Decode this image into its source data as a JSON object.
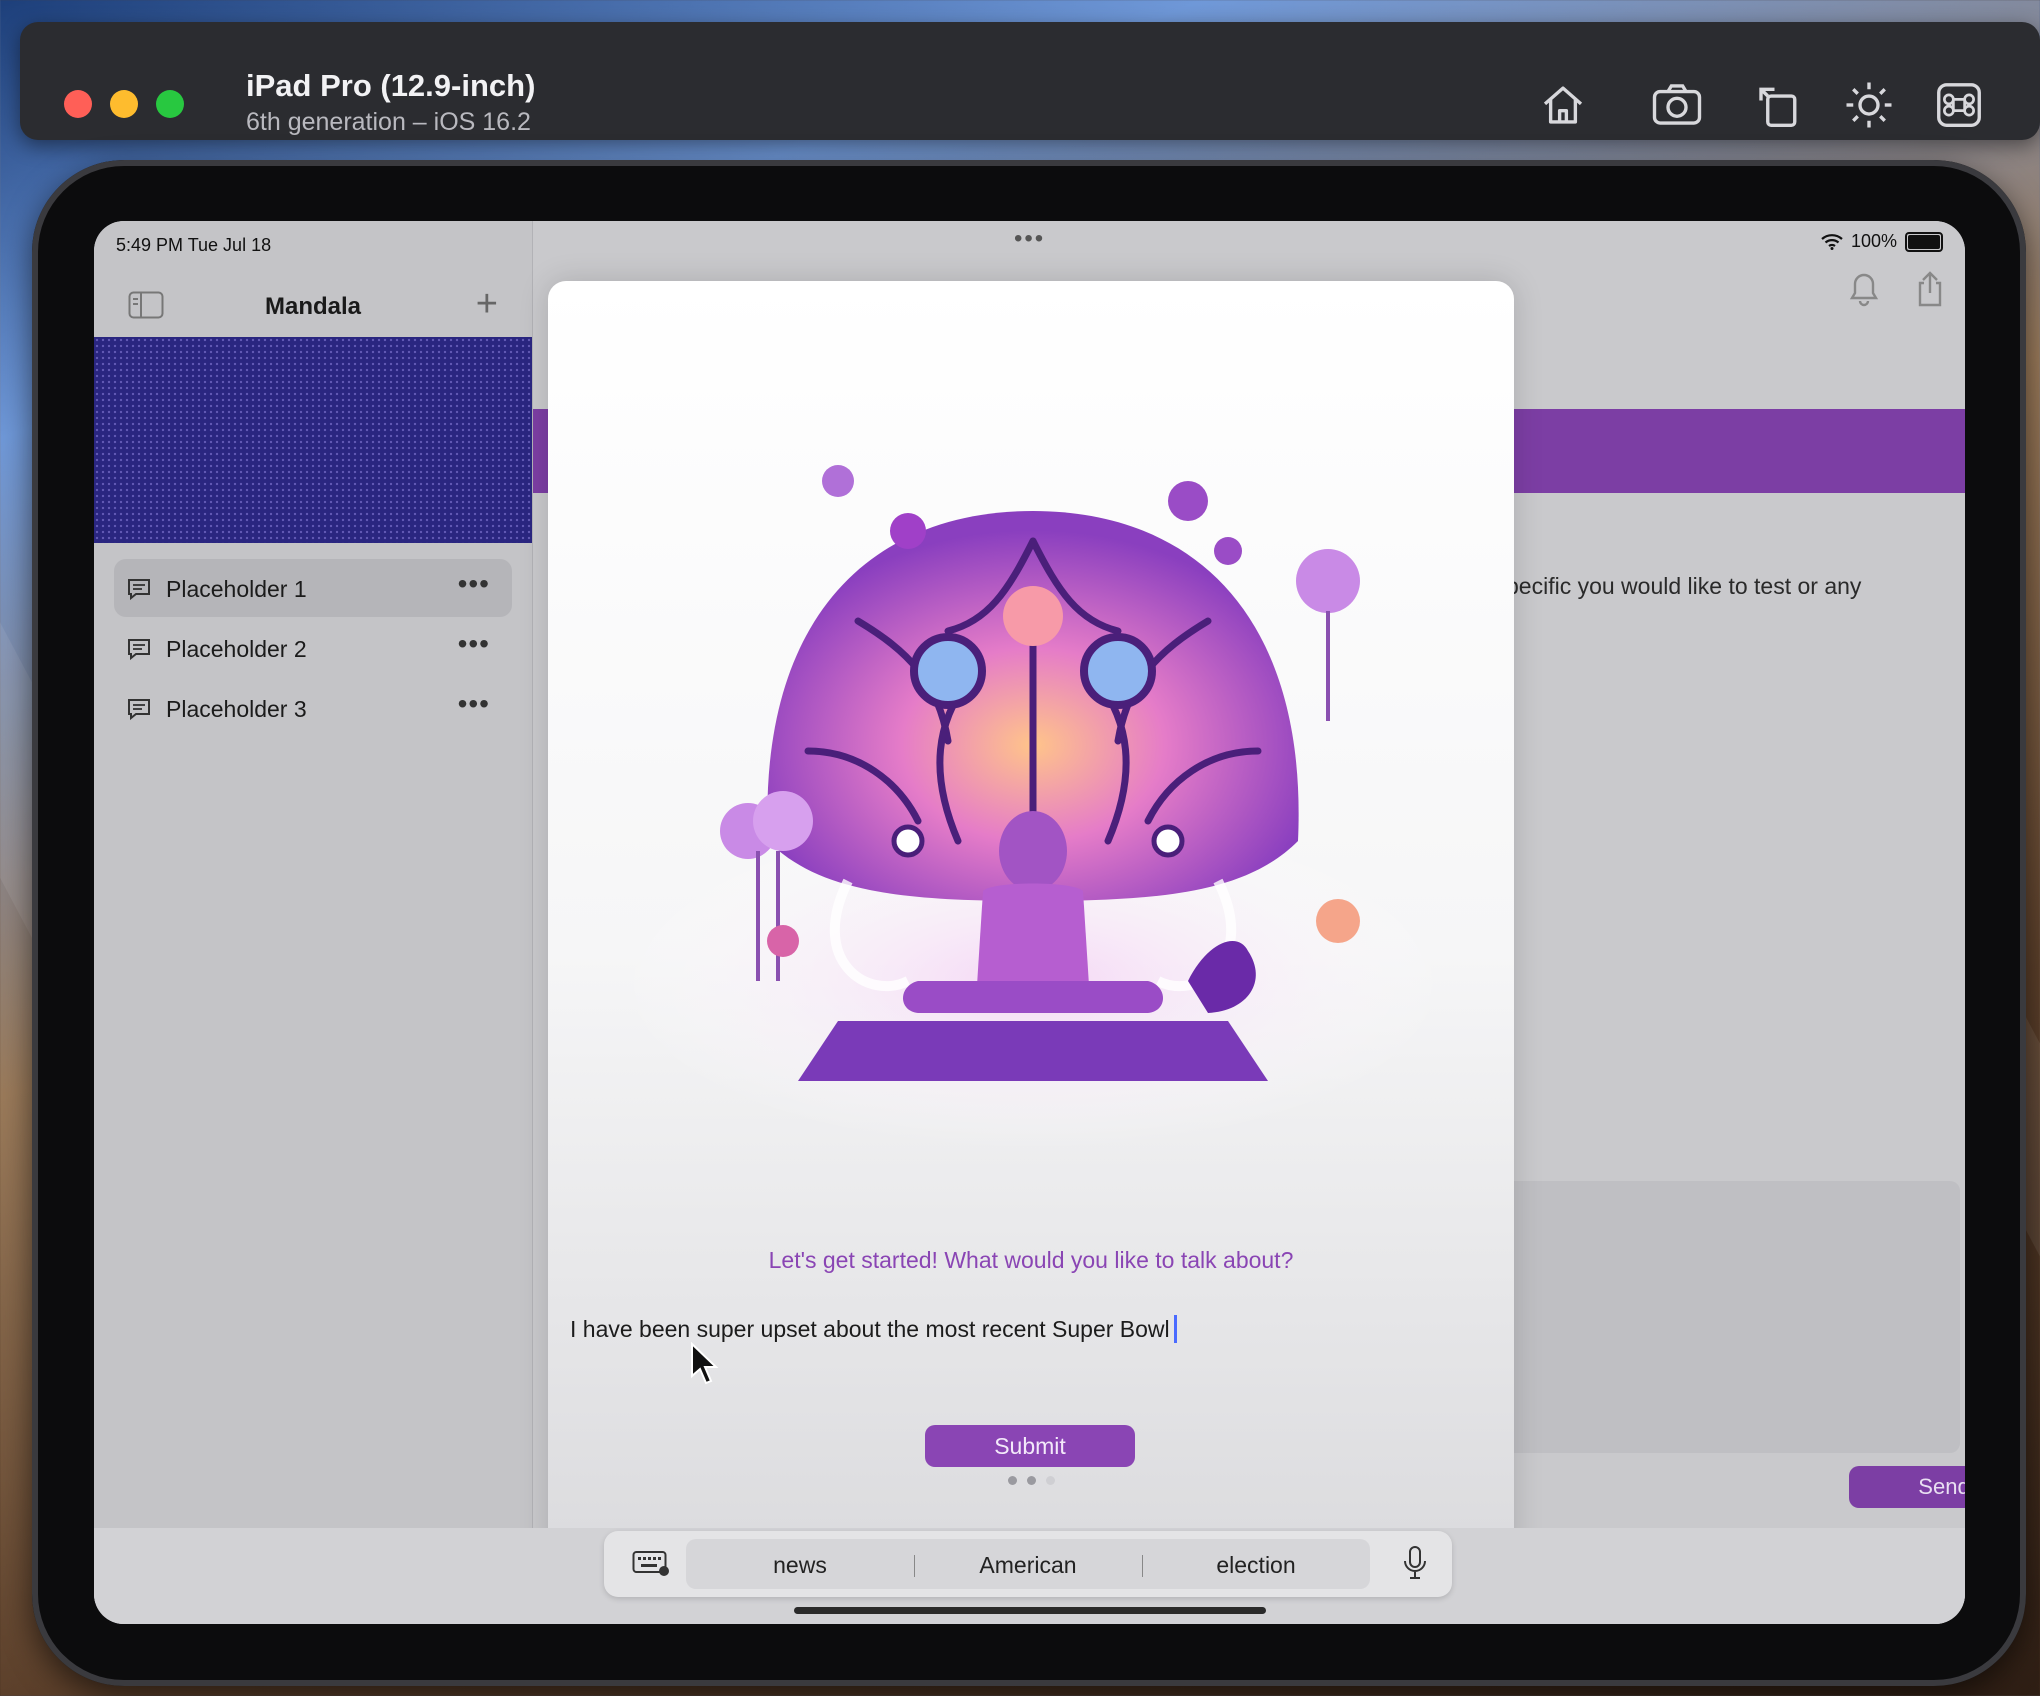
{
  "simulator": {
    "device_name": "iPad Pro (12.9-inch)",
    "device_subtitle": "6th generation – iOS 16.2",
    "toolbar_icons": [
      "home-icon",
      "screenshot-icon",
      "rotate-icon",
      "brightness-icon",
      "command-icon"
    ]
  },
  "status_bar": {
    "time": "5:49 PM   Tue Jul 18",
    "battery": "100%"
  },
  "sidebar": {
    "title": "Mandala",
    "items": [
      {
        "label": "Placeholder 1",
        "selected": true
      },
      {
        "label": "Placeholder 2",
        "selected": false
      },
      {
        "label": "Placeholder 3",
        "selected": false
      }
    ]
  },
  "main": {
    "partial_text": "pecific you would like to test or any",
    "send_label": "Send",
    "toolbar_icons": [
      "bell-icon",
      "share-icon",
      "compose-icon"
    ],
    "accent_color": "#7c3ea4"
  },
  "modal": {
    "prompt": "Let's get started! What would you like to talk about?",
    "input_value": "I have been super upset about the most recent Super Bowl",
    "submit_label": "Submit",
    "accent_color": "#8a45b4"
  },
  "keyboard": {
    "suggestions": [
      "news",
      "American",
      "election"
    ]
  }
}
